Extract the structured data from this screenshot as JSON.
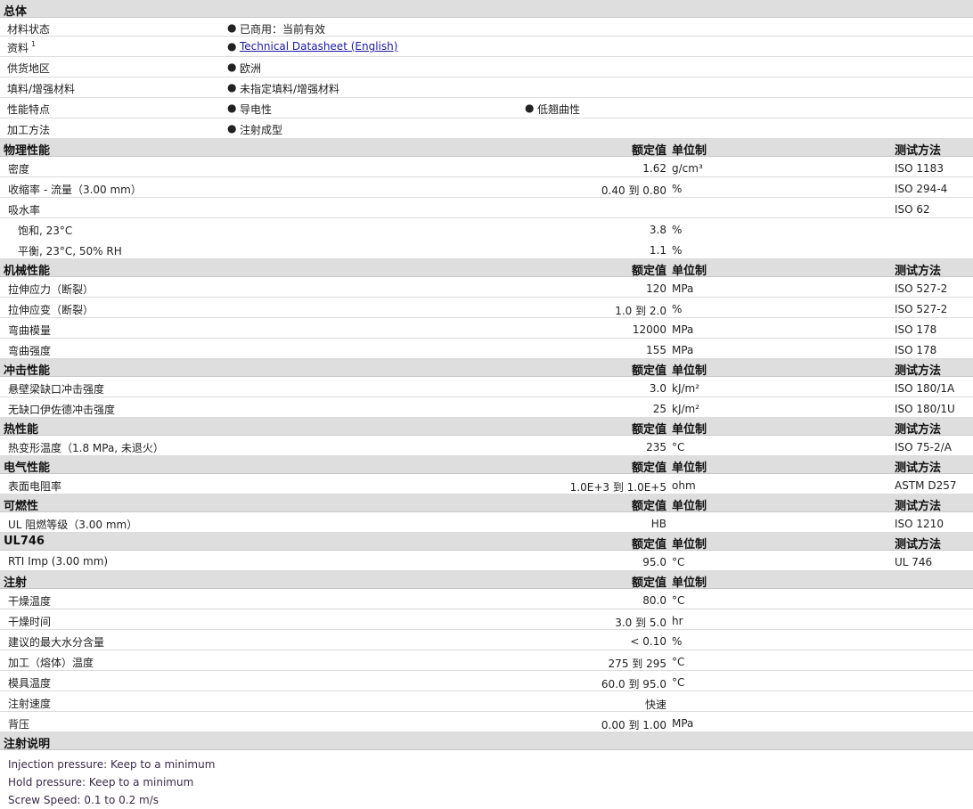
{
  "general": {
    "title": "总体",
    "rows": [
      {
        "label": "材料状态",
        "items": [
          "已商用：当前有效"
        ]
      },
      {
        "label": "资料",
        "sup": "1",
        "items": [
          "Technical Datasheet (English)"
        ],
        "link": true
      },
      {
        "label": "供货地区",
        "items": [
          "欧洲"
        ]
      },
      {
        "label": "填料/增强材料",
        "items": [
          "未指定填料/增强材料"
        ]
      },
      {
        "label": "性能特点",
        "items": [
          "导电性",
          "低翘曲性"
        ]
      },
      {
        "label": "加工方法",
        "items": [
          "注射成型"
        ]
      }
    ]
  },
  "columns": {
    "nominal": "额定值",
    "unit": "单位制",
    "test": "测试方法"
  },
  "sections": [
    {
      "title": "物理性能",
      "rows": [
        {
          "label": "密度",
          "value": "1.62",
          "unit": "g/cm³",
          "test": "ISO 1183"
        },
        {
          "label": "收缩率 - 流量（3.00 mm）",
          "value": "0.40 到  0.80",
          "unit": "%",
          "test": "ISO 294-4"
        },
        {
          "label": "吸水率",
          "value": "",
          "unit": "",
          "test": "ISO 62"
        },
        {
          "label": "饱和, 23°C",
          "value": "3.8",
          "unit": "%",
          "test": "",
          "indent": true,
          "nodiv": true
        },
        {
          "label": "平衡, 23°C, 50% RH",
          "value": "1.1",
          "unit": "%",
          "test": "",
          "indent": true
        }
      ]
    },
    {
      "title": "机械性能",
      "rows": [
        {
          "label": "拉伸应力（断裂）",
          "value": "120",
          "unit": "MPa",
          "test": "ISO 527-2"
        },
        {
          "label": "拉伸应变（断裂）",
          "value": "1.0 到  2.0",
          "unit": "%",
          "test": "ISO 527-2"
        },
        {
          "label": "弯曲模量",
          "value": "12000",
          "unit": "MPa",
          "test": "ISO 178"
        },
        {
          "label": "弯曲强度",
          "value": "155",
          "unit": "MPa",
          "test": "ISO 178"
        }
      ]
    },
    {
      "title": "冲击性能",
      "rows": [
        {
          "label": "悬壁梁缺口冲击强度",
          "value": "3.0",
          "unit": "kJ/m²",
          "test": "ISO 180/1A"
        },
        {
          "label": "无缺口伊佐德冲击强度",
          "value": "25",
          "unit": "kJ/m²",
          "test": "ISO 180/1U"
        }
      ]
    },
    {
      "title": "热性能",
      "rows": [
        {
          "label": "热变形温度（1.8 MPa, 未退火）",
          "value": "235",
          "unit": "°C",
          "test": "ISO 75-2/A"
        }
      ]
    },
    {
      "title": "电气性能",
      "rows": [
        {
          "label": "表面电阻率",
          "value": "1.0E+3 到  1.0E+5",
          "unit": "ohm",
          "test": "ASTM D257"
        }
      ]
    },
    {
      "title": "可燃性",
      "rows": [
        {
          "label": "UL 阻燃等级（3.00 mm）",
          "value": "HB",
          "unit": "",
          "test": "ISO 1210"
        }
      ]
    },
    {
      "title": "UL746",
      "rows": [
        {
          "label": "RTI Imp (3.00 mm)",
          "value": "95.0",
          "unit": "°C",
          "test": "UL 746"
        }
      ]
    },
    {
      "title": "注射",
      "noTest": true,
      "rows": [
        {
          "label": "干燥温度",
          "value": "80.0",
          "unit": "°C",
          "test": ""
        },
        {
          "label": "干燥时间",
          "value": "3.0 到  5.0",
          "unit": "hr",
          "test": ""
        },
        {
          "label": "建议的最大水分含量",
          "value": "< 0.10",
          "unit": "%",
          "test": ""
        },
        {
          "label": "加工（熔体）温度",
          "value": "275 到  295",
          "unit": "°C",
          "test": ""
        },
        {
          "label": "模具温度",
          "value": "60.0 到  95.0",
          "unit": "°C",
          "test": ""
        },
        {
          "label": "注射速度",
          "value": "快速",
          "unit": "",
          "test": ""
        },
        {
          "label": "背压",
          "value": "0.00 到  1.00",
          "unit": "MPa",
          "test": ""
        }
      ]
    }
  ],
  "notes": {
    "title": "注射说明",
    "lines": [
      "Injection pressure: Keep to a minimum",
      "Hold pressure: Keep to a minimum",
      "Screw Speed: 0.1 to 0.2 m/s"
    ]
  }
}
